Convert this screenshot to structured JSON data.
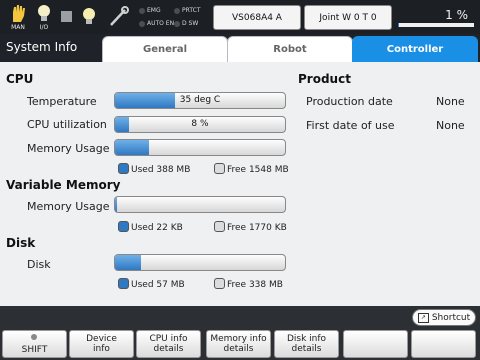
{
  "topbar": {
    "man_label": "MAN",
    "io_label": "I/O",
    "indicators": [
      "EMG",
      "AUTO EN",
      "PRTCT",
      "D SW"
    ],
    "robot_name": "VS068A4 A",
    "coord": "Joint W 0 T 0",
    "speed_percent": "1 %",
    "speed_fraction": 0.01,
    "accent_color": "#2a7fd4"
  },
  "header": {
    "title": "System Info",
    "tabs": [
      "General",
      "Robot",
      "Controller"
    ],
    "active_tab": "Controller"
  },
  "cpu": {
    "heading": "CPU",
    "temperature_label": "Temperature",
    "temperature_value": "35 deg C",
    "temperature_fraction": 0.35,
    "utilization_label": "CPU utilization",
    "utilization_value": "8 %",
    "utilization_fraction": 0.08,
    "memory_label": "Memory Usage",
    "memory_fraction": 0.2,
    "memory_used": "Used 388 MB",
    "memory_free": "Free 1548 MB"
  },
  "variable_memory": {
    "heading": "Variable Memory",
    "label": "Memory Usage",
    "fraction": 0.01,
    "used": "Used 22 KB",
    "free": "Free 1770 KB"
  },
  "disk": {
    "heading": "Disk",
    "label": "Disk",
    "fraction": 0.15,
    "used": "Used 57 MB",
    "free": "Free 338 MB"
  },
  "product": {
    "heading": "Product",
    "production_date_label": "Production date",
    "production_date_value": "None",
    "first_use_label": "First date of use",
    "first_use_value": "None"
  },
  "footer": {
    "shortcut": "Shortcut",
    "shift": "SHIFT",
    "device_info_1": "Device",
    "device_info_2": "info",
    "cpu_info_1": "CPU info",
    "cpu_info_2": "details",
    "memory_info_1": "Memory info",
    "memory_info_2": "details",
    "disk_info_1": "Disk info",
    "disk_info_2": "details"
  }
}
